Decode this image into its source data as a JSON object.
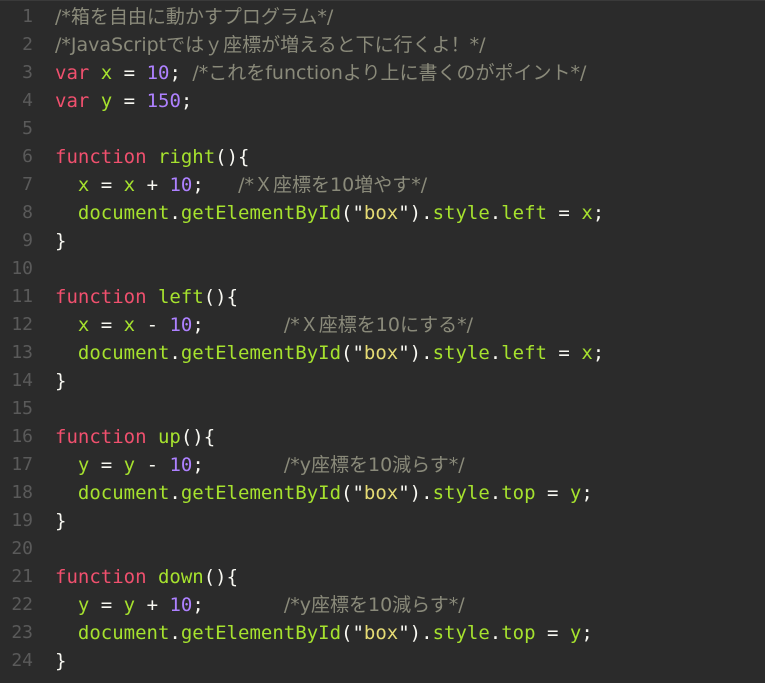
{
  "colors": {
    "background": "#2b2b2b",
    "line_number": "#5a5a5a",
    "keyword": "#f0506e",
    "identifier": "#a6e22e",
    "number": "#ae81ff",
    "string": "#e6db74",
    "comment": "#8a8a7a",
    "plain": "#f8f8f2"
  },
  "lines": [
    {
      "n": "1",
      "tokens": [
        {
          "t": "cm",
          "v": "/*箱を自由に動かすプログラム*/"
        }
      ]
    },
    {
      "n": "2",
      "tokens": [
        {
          "t": "cm",
          "v": "/*JavaScriptではｙ座標が増えると下に行くよ！*/"
        }
      ]
    },
    {
      "n": "3",
      "tokens": [
        {
          "t": "kw",
          "v": "var"
        },
        {
          "t": "pl",
          "v": " "
        },
        {
          "t": "fn",
          "v": "x"
        },
        {
          "t": "pl",
          "v": " = "
        },
        {
          "t": "num",
          "v": "10"
        },
        {
          "t": "pl",
          "v": "; "
        },
        {
          "t": "cm",
          "v": "/*これをfunctionより上に書くのがポイント*/"
        }
      ]
    },
    {
      "n": "4",
      "tokens": [
        {
          "t": "kw",
          "v": "var"
        },
        {
          "t": "pl",
          "v": " "
        },
        {
          "t": "fn",
          "v": "y"
        },
        {
          "t": "pl",
          "v": " = "
        },
        {
          "t": "num",
          "v": "150"
        },
        {
          "t": "pl",
          "v": ";"
        }
      ]
    },
    {
      "n": "5",
      "tokens": []
    },
    {
      "n": "6",
      "tokens": [
        {
          "t": "kw",
          "v": "function"
        },
        {
          "t": "pl",
          "v": " "
        },
        {
          "t": "fn",
          "v": "right"
        },
        {
          "t": "pl",
          "v": "(){"
        }
      ]
    },
    {
      "n": "7",
      "tokens": [
        {
          "t": "pl",
          "v": "  "
        },
        {
          "t": "fn",
          "v": "x"
        },
        {
          "t": "pl",
          "v": " = "
        },
        {
          "t": "fn",
          "v": "x"
        },
        {
          "t": "pl",
          "v": " + "
        },
        {
          "t": "num",
          "v": "10"
        },
        {
          "t": "pl",
          "v": ";   "
        },
        {
          "t": "cm",
          "v": "/*Ｘ座標を10増やす*/"
        }
      ]
    },
    {
      "n": "8",
      "tokens": [
        {
          "t": "pl",
          "v": "  "
        },
        {
          "t": "fn",
          "v": "document"
        },
        {
          "t": "pl",
          "v": "."
        },
        {
          "t": "fn",
          "v": "getElementById"
        },
        {
          "t": "pl",
          "v": "(\""
        },
        {
          "t": "str",
          "v": "box"
        },
        {
          "t": "pl",
          "v": "\")."
        },
        {
          "t": "fn",
          "v": "style"
        },
        {
          "t": "pl",
          "v": "."
        },
        {
          "t": "fn",
          "v": "left"
        },
        {
          "t": "pl",
          "v": " = "
        },
        {
          "t": "fn",
          "v": "x"
        },
        {
          "t": "pl",
          "v": ";"
        }
      ]
    },
    {
      "n": "9",
      "tokens": [
        {
          "t": "pl",
          "v": "}"
        }
      ]
    },
    {
      "n": "10",
      "tokens": []
    },
    {
      "n": "11",
      "tokens": [
        {
          "t": "kw",
          "v": "function"
        },
        {
          "t": "pl",
          "v": " "
        },
        {
          "t": "fn",
          "v": "left"
        },
        {
          "t": "pl",
          "v": "(){"
        }
      ]
    },
    {
      "n": "12",
      "tokens": [
        {
          "t": "pl",
          "v": "  "
        },
        {
          "t": "fn",
          "v": "x"
        },
        {
          "t": "pl",
          "v": " = "
        },
        {
          "t": "fn",
          "v": "x"
        },
        {
          "t": "pl",
          "v": " - "
        },
        {
          "t": "num",
          "v": "10"
        },
        {
          "t": "pl",
          "v": ";       "
        },
        {
          "t": "cm",
          "v": "/*Ｘ座標を10にする*/"
        }
      ]
    },
    {
      "n": "13",
      "tokens": [
        {
          "t": "pl",
          "v": "  "
        },
        {
          "t": "fn",
          "v": "document"
        },
        {
          "t": "pl",
          "v": "."
        },
        {
          "t": "fn",
          "v": "getElementById"
        },
        {
          "t": "pl",
          "v": "(\""
        },
        {
          "t": "str",
          "v": "box"
        },
        {
          "t": "pl",
          "v": "\")."
        },
        {
          "t": "fn",
          "v": "style"
        },
        {
          "t": "pl",
          "v": "."
        },
        {
          "t": "fn",
          "v": "left"
        },
        {
          "t": "pl",
          "v": " = "
        },
        {
          "t": "fn",
          "v": "x"
        },
        {
          "t": "pl",
          "v": ";"
        }
      ]
    },
    {
      "n": "14",
      "tokens": [
        {
          "t": "pl",
          "v": "}"
        }
      ]
    },
    {
      "n": "15",
      "tokens": []
    },
    {
      "n": "16",
      "tokens": [
        {
          "t": "kw",
          "v": "function"
        },
        {
          "t": "pl",
          "v": " "
        },
        {
          "t": "fn",
          "v": "up"
        },
        {
          "t": "pl",
          "v": "(){"
        }
      ]
    },
    {
      "n": "17",
      "tokens": [
        {
          "t": "pl",
          "v": "  "
        },
        {
          "t": "fn",
          "v": "y"
        },
        {
          "t": "pl",
          "v": " = "
        },
        {
          "t": "fn",
          "v": "y"
        },
        {
          "t": "pl",
          "v": " - "
        },
        {
          "t": "num",
          "v": "10"
        },
        {
          "t": "pl",
          "v": ";       "
        },
        {
          "t": "cm",
          "v": "/*y座標を10減らす*/"
        }
      ]
    },
    {
      "n": "18",
      "tokens": [
        {
          "t": "pl",
          "v": "  "
        },
        {
          "t": "fn",
          "v": "document"
        },
        {
          "t": "pl",
          "v": "."
        },
        {
          "t": "fn",
          "v": "getElementById"
        },
        {
          "t": "pl",
          "v": "(\""
        },
        {
          "t": "str",
          "v": "box"
        },
        {
          "t": "pl",
          "v": "\")."
        },
        {
          "t": "fn",
          "v": "style"
        },
        {
          "t": "pl",
          "v": "."
        },
        {
          "t": "fn",
          "v": "top"
        },
        {
          "t": "pl",
          "v": " = "
        },
        {
          "t": "fn",
          "v": "y"
        },
        {
          "t": "pl",
          "v": ";"
        }
      ]
    },
    {
      "n": "19",
      "tokens": [
        {
          "t": "pl",
          "v": "}"
        }
      ]
    },
    {
      "n": "20",
      "tokens": []
    },
    {
      "n": "21",
      "tokens": [
        {
          "t": "kw",
          "v": "function"
        },
        {
          "t": "pl",
          "v": " "
        },
        {
          "t": "fn",
          "v": "down"
        },
        {
          "t": "pl",
          "v": "(){"
        }
      ]
    },
    {
      "n": "22",
      "tokens": [
        {
          "t": "pl",
          "v": "  "
        },
        {
          "t": "fn",
          "v": "y"
        },
        {
          "t": "pl",
          "v": " = "
        },
        {
          "t": "fn",
          "v": "y"
        },
        {
          "t": "pl",
          "v": " + "
        },
        {
          "t": "num",
          "v": "10"
        },
        {
          "t": "pl",
          "v": ";       "
        },
        {
          "t": "cm",
          "v": "/*y座標を10減らす*/"
        }
      ]
    },
    {
      "n": "23",
      "tokens": [
        {
          "t": "pl",
          "v": "  "
        },
        {
          "t": "fn",
          "v": "document"
        },
        {
          "t": "pl",
          "v": "."
        },
        {
          "t": "fn",
          "v": "getElementById"
        },
        {
          "t": "pl",
          "v": "(\""
        },
        {
          "t": "str",
          "v": "box"
        },
        {
          "t": "pl",
          "v": "\")."
        },
        {
          "t": "fn",
          "v": "style"
        },
        {
          "t": "pl",
          "v": "."
        },
        {
          "t": "fn",
          "v": "top"
        },
        {
          "t": "pl",
          "v": " = "
        },
        {
          "t": "fn",
          "v": "y"
        },
        {
          "t": "pl",
          "v": ";"
        }
      ]
    },
    {
      "n": "24",
      "tokens": [
        {
          "t": "pl",
          "v": "}"
        }
      ]
    }
  ]
}
